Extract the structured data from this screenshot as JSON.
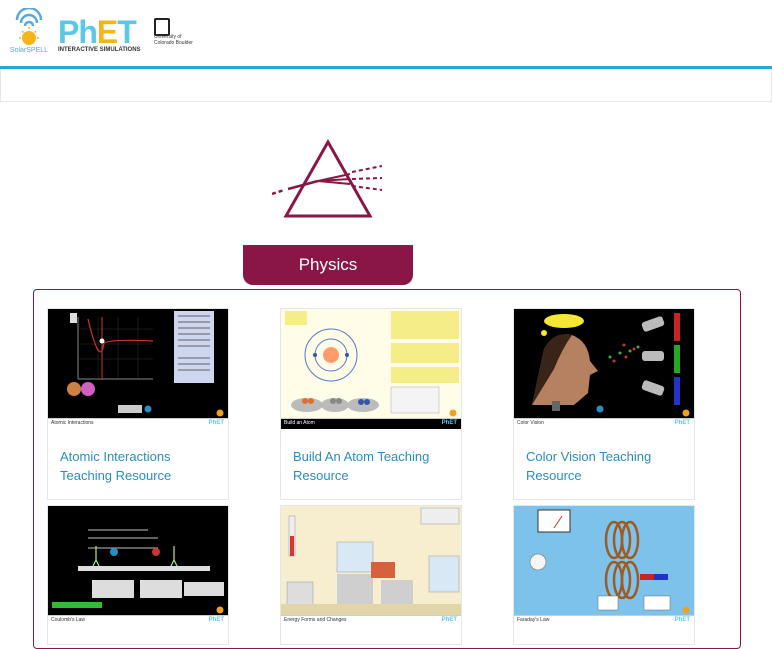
{
  "header": {
    "solarspell_label": "SolarSPELL",
    "phet_word_p": "P",
    "phet_word_h": "h",
    "phet_word_e": "E",
    "phet_word_t": "T",
    "phet_subtitle": "INTERACTIVE SIMULATIONS",
    "university_text": "University of Colorado Boulder",
    "accent_color": "#2aa5d8"
  },
  "category": {
    "icon": "prism-icon",
    "label": "Physics",
    "color": "#8a1646"
  },
  "cards": [
    {
      "title": "Atomic Interactions Teaching Resource",
      "sim_label": "Atomic Interactions"
    },
    {
      "title": "Build An Atom Teaching Resource",
      "sim_label": "Build an Atom"
    },
    {
      "title": "Color Vision Teaching Resource",
      "sim_label": "Color Vision"
    },
    {
      "title": "",
      "sim_label": "Coulomb's Law"
    },
    {
      "title": "",
      "sim_label": "Energy Forms and Changes"
    },
    {
      "title": "",
      "sim_label": "Faraday's Law"
    }
  ],
  "sim_bar_logo": "PhET"
}
